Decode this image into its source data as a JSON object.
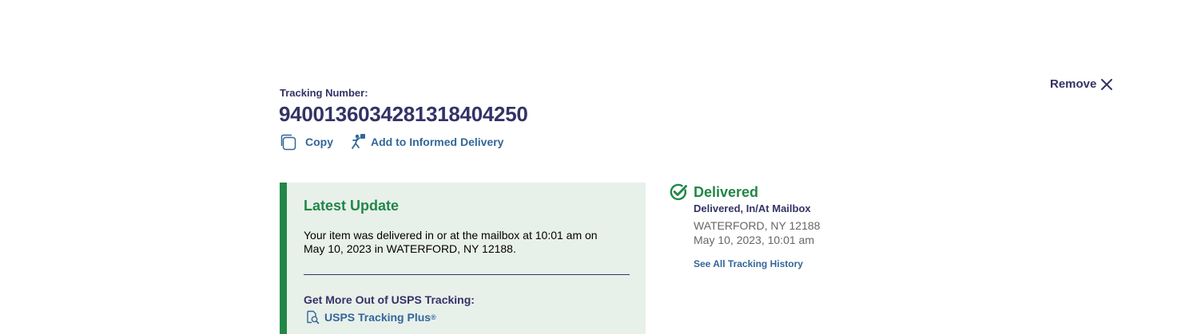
{
  "tracking": {
    "label": "Tracking Number:",
    "number": "9400136034281318404250",
    "remove_label": "Remove",
    "copy_label": "Copy",
    "informed_label": "Add to Informed Delivery"
  },
  "latest_update": {
    "title": "Latest Update",
    "text": "Your item was delivered in or at the mailbox at 10:01 am on May 10, 2023 in WATERFORD, NY 12188.",
    "more_label": "Get More Out of USPS Tracking:",
    "plus_label": "USPS Tracking Plus",
    "plus_mark": "®"
  },
  "status": {
    "title": "Delivered",
    "detail": "Delivered, In/At Mailbox",
    "location": "WATERFORD, NY 12188",
    "time": "May 10, 2023, 10:01 am",
    "history_link": "See All Tracking History"
  },
  "colors": {
    "navy": "#333366",
    "green": "#218748",
    "link_blue": "#336699",
    "panel_bg": "#e8f0ea"
  },
  "icons": {
    "remove": "close-icon",
    "copy": "copy-icon",
    "informed": "informed-delivery-icon",
    "plus": "tracking-plus-icon",
    "status": "check-circle-icon"
  }
}
